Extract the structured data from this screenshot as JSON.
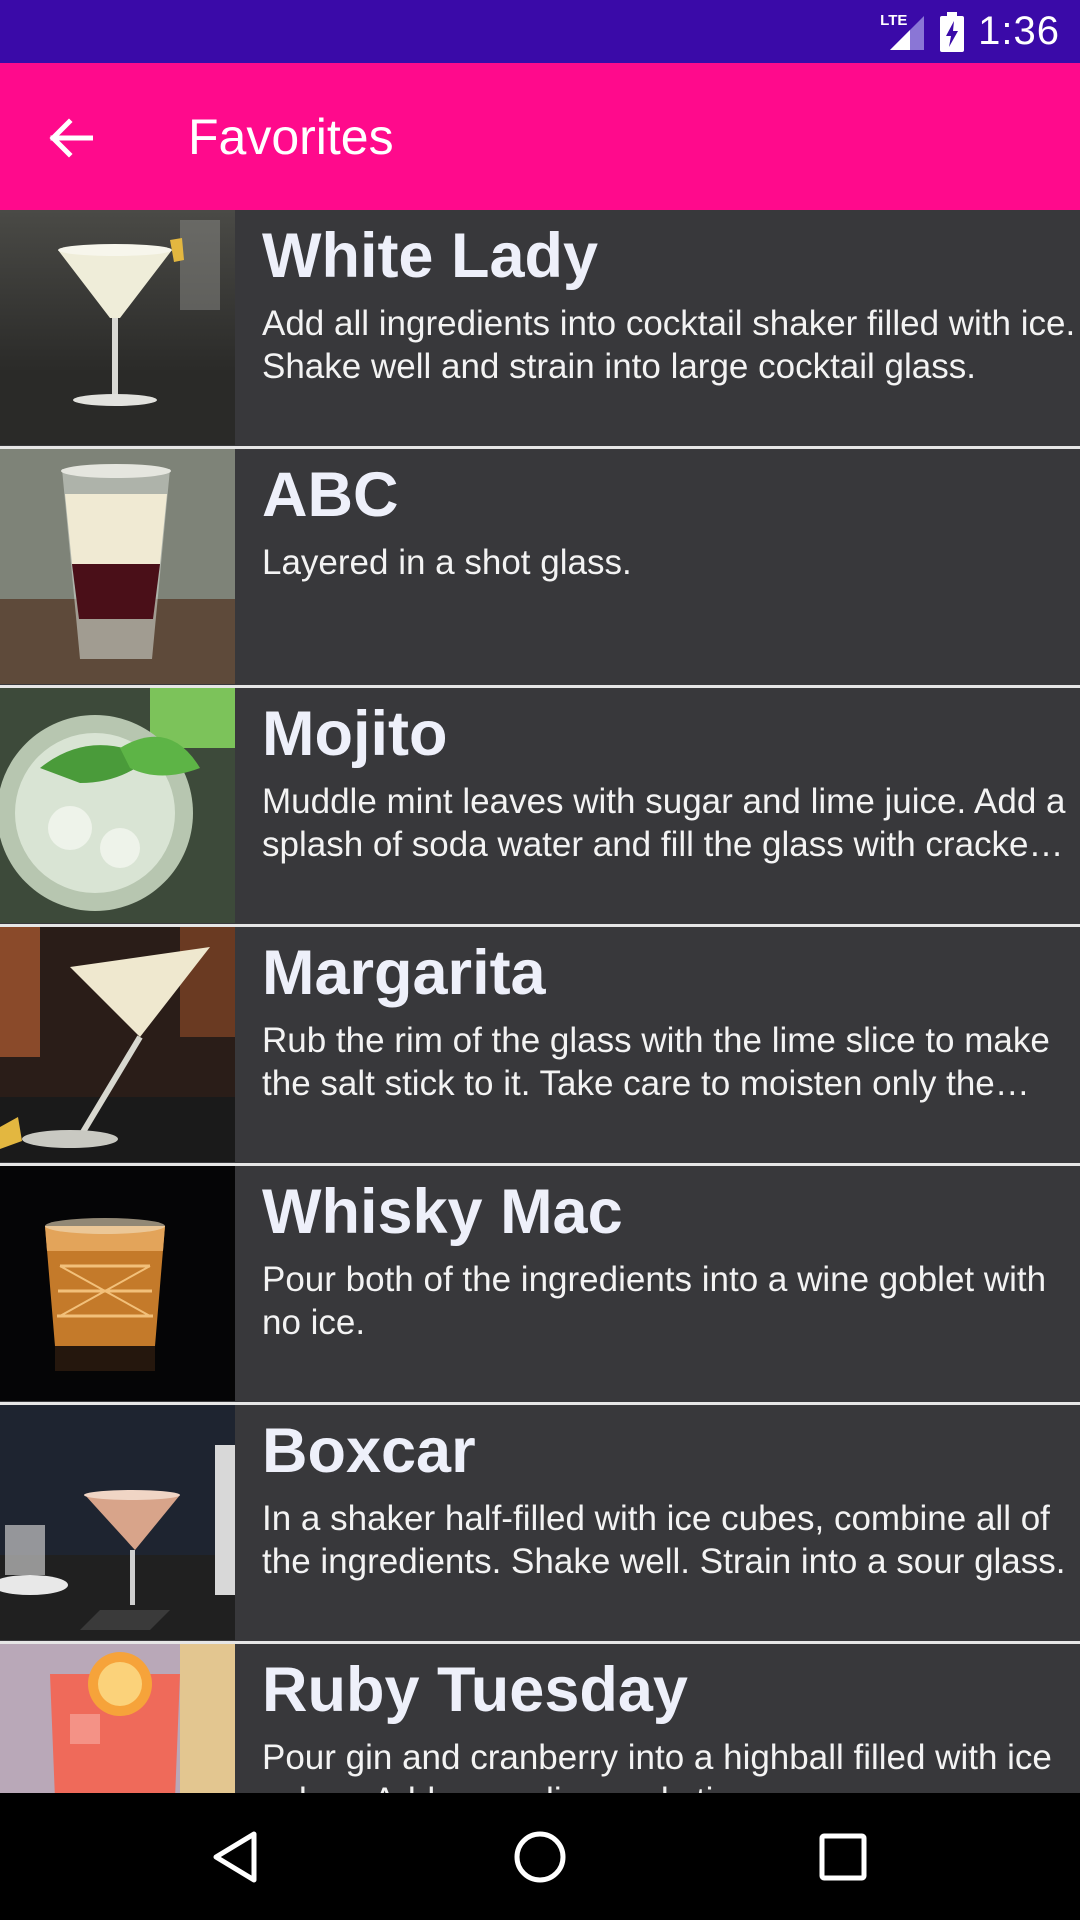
{
  "status_bar": {
    "network": "LTE",
    "time": "1:36"
  },
  "app_bar": {
    "title": "Favorites",
    "back_icon": "arrow-back-icon"
  },
  "cocktails": [
    {
      "name": "White Lady",
      "description": "Add all ingredients into cocktail shaker filled with ice. Shake well and strain into large cocktail glass."
    },
    {
      "name": "ABC",
      "description": "Layered in a shot glass."
    },
    {
      "name": "Mojito",
      "description": "Muddle mint leaves with sugar and lime juice. Add a splash of soda water and fill the glass with cracked ice."
    },
    {
      "name": "Margarita",
      "description": "Rub the rim of the glass with the lime slice to make the salt stick to it. Take care to moisten only the outer rim."
    },
    {
      "name": "Whisky Mac",
      "description": "Pour both of the ingredients into a wine goblet with no ice."
    },
    {
      "name": "Boxcar",
      "description": "In a shaker half-filled with ice cubes, combine all of the ingredients. Shake well. Strain into a sour glass."
    },
    {
      "name": "Ruby Tuesday",
      "description": "Pour gin and cranberry into a highball filled with ice cubes. Add grenadine and stir."
    }
  ],
  "nav_bar": {
    "back_icon": "nav-back-icon",
    "home_icon": "nav-home-icon",
    "recents_icon": "nav-recents-icon"
  },
  "colors": {
    "status_bar": "#3a0aa8",
    "app_bar": "#ff0a8c",
    "list_background": "#38383b",
    "divider": "#e6e6e6"
  }
}
